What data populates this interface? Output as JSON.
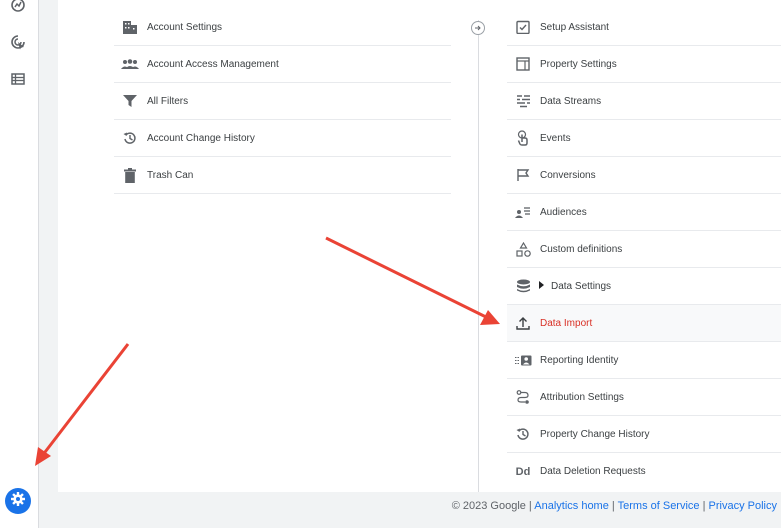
{
  "left_nav": {
    "icons": [
      "explore-icon",
      "advertising-icon",
      "configure-icon"
    ],
    "admin_icon": "gear-icon"
  },
  "account_column": {
    "items": [
      {
        "label": "Account Settings",
        "icon": "building-icon"
      },
      {
        "label": "Account Access Management",
        "icon": "people-icon"
      },
      {
        "label": "All Filters",
        "icon": "filter-icon"
      },
      {
        "label": "Account Change History",
        "icon": "history-icon"
      },
      {
        "label": "Trash Can",
        "icon": "trash-icon"
      }
    ]
  },
  "property_column": {
    "items": [
      {
        "label": "Setup Assistant",
        "icon": "checklist-icon"
      },
      {
        "label": "Property Settings",
        "icon": "window-icon"
      },
      {
        "label": "Data Streams",
        "icon": "streams-icon"
      },
      {
        "label": "Events",
        "icon": "touch-icon"
      },
      {
        "label": "Conversions",
        "icon": "flag-icon"
      },
      {
        "label": "Audiences",
        "icon": "audience-icon"
      },
      {
        "label": "Custom definitions",
        "icon": "shapes-icon"
      },
      {
        "label": "Data Settings",
        "icon": "database-icon"
      },
      {
        "label": "Data Import",
        "icon": "upload-icon"
      },
      {
        "label": "Reporting Identity",
        "icon": "identity-icon"
      },
      {
        "label": "Attribution Settings",
        "icon": "attribution-icon"
      },
      {
        "label": "Property Change History",
        "icon": "history-icon"
      },
      {
        "label": "Data Deletion Requests",
        "icon": "dd-icon"
      }
    ],
    "dd_text": "Dd"
  },
  "footer": {
    "copyright": "© 2023 Google | ",
    "links": [
      "Analytics home",
      "Terms of Service",
      "Privacy Policy"
    ],
    "sep": " | "
  },
  "colors": {
    "active": "#d93025",
    "accent": "#1a73e8",
    "arrow": "#ea4335"
  }
}
